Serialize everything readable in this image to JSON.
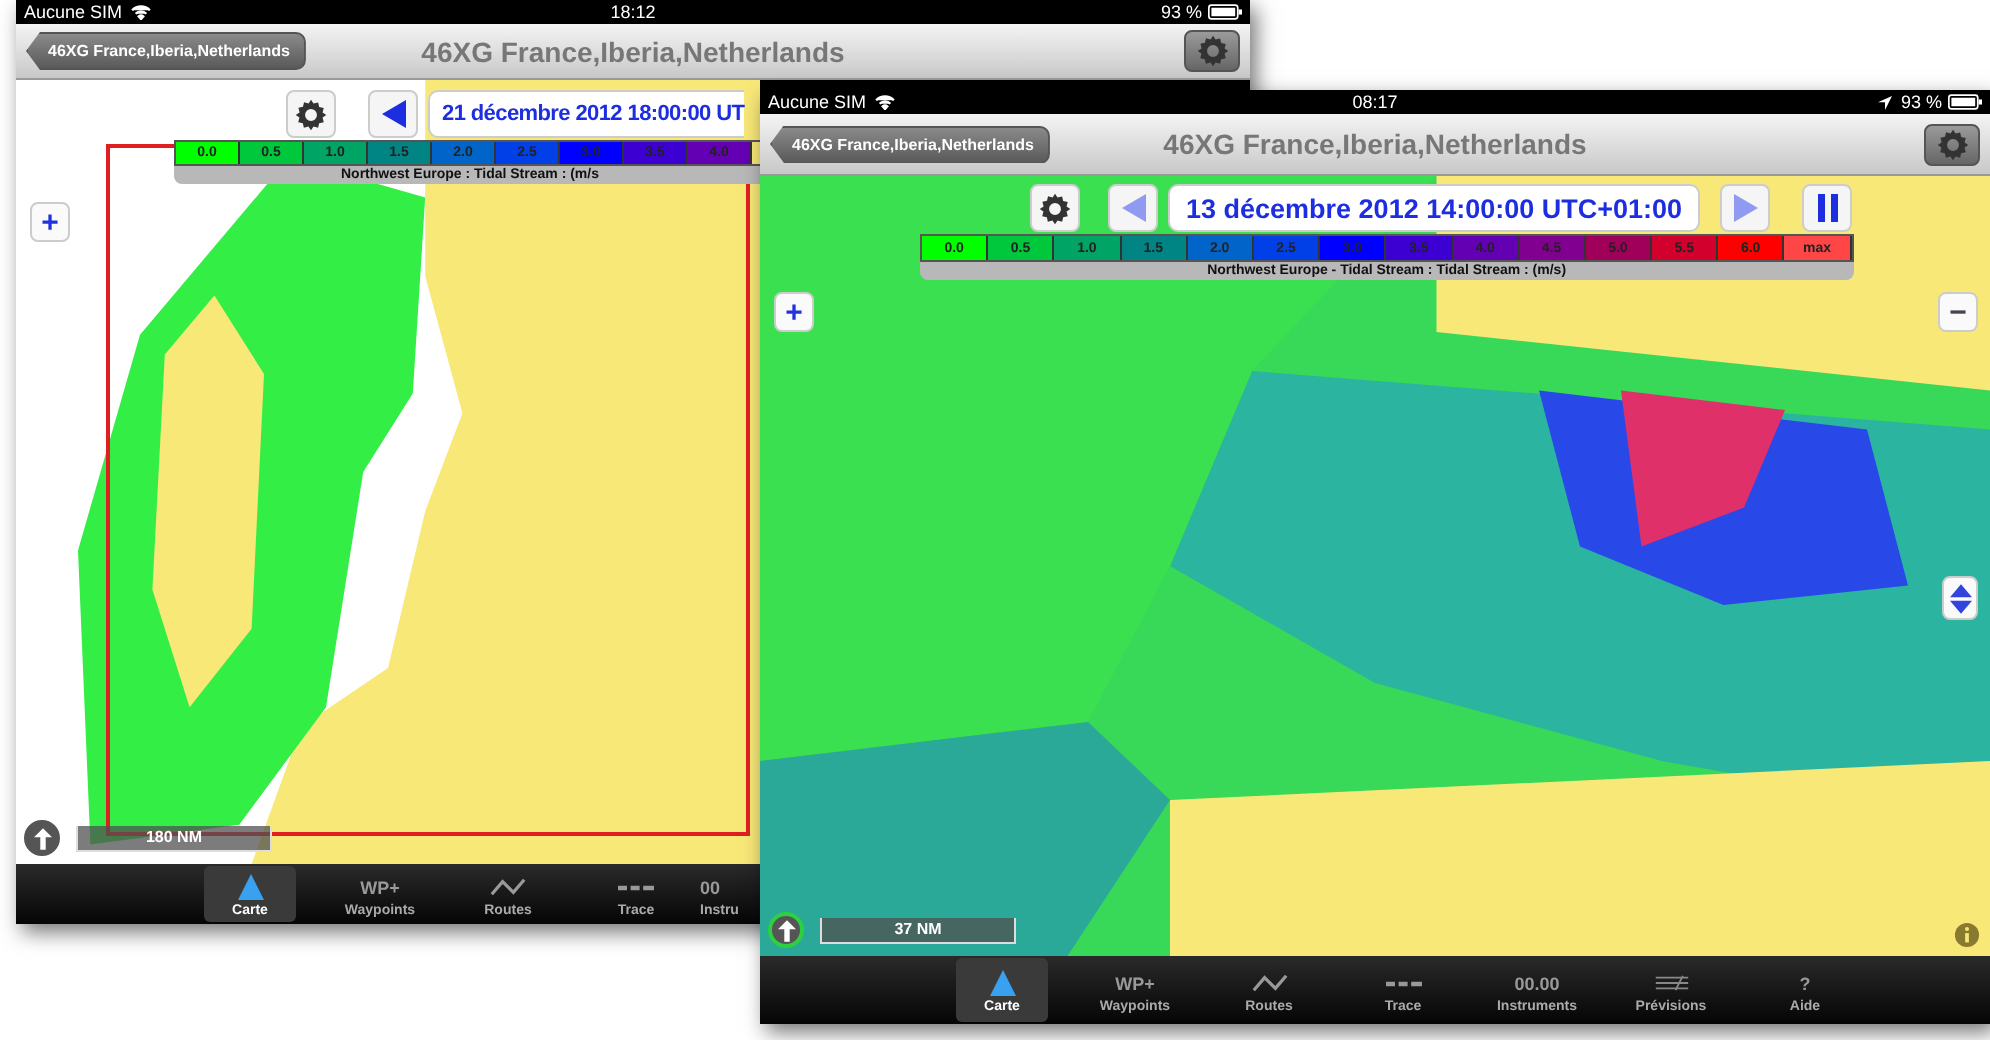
{
  "back_screen": {
    "status_bar": {
      "carrier": "Aucune SIM",
      "time": "18:12",
      "battery": "93 %"
    },
    "nav_bar": {
      "back_button": "46XG France,Iberia,Netherlands",
      "title": "46XG France,Iberia,Netherlands"
    },
    "map_controls": {
      "date": "21 décembre 2012 18:00:00 UT",
      "zoom_in": "+",
      "scale": "180 NM"
    },
    "legend": {
      "cells": [
        {
          "label": "0.0",
          "color": "#00ff00"
        },
        {
          "label": "0.5",
          "color": "#00c83c"
        },
        {
          "label": "1.0",
          "color": "#00a464"
        },
        {
          "label": "1.5",
          "color": "#008484"
        },
        {
          "label": "2.0",
          "color": "#0064c8"
        },
        {
          "label": "2.5",
          "color": "#0040e6"
        },
        {
          "label": "3.0",
          "color": "#0000ff"
        },
        {
          "label": "3.5",
          "color": "#3c00d2"
        },
        {
          "label": "4.0",
          "color": "#6400b4"
        }
      ],
      "caption": "Northwest Europe : Tidal Stream : (m/s"
    },
    "tabs": [
      {
        "label": "Carte",
        "kind": "triangle",
        "selected": true
      },
      {
        "label": "Waypoints",
        "kind": "text",
        "glyph": "WP+",
        "selected": false
      },
      {
        "label": "Routes",
        "kind": "zigzag",
        "selected": false
      },
      {
        "label": "Trace",
        "kind": "dashes",
        "selected": false
      },
      {
        "label": "Instru",
        "kind": "text",
        "glyph": "00",
        "selected": false
      }
    ]
  },
  "front_screen": {
    "status_bar": {
      "carrier": "Aucune SIM",
      "time": "08:17",
      "battery": "93 %"
    },
    "nav_bar": {
      "back_button": "46XG France,Iberia,Netherlands",
      "title": "46XG France,Iberia,Netherlands"
    },
    "map_controls": {
      "date": "13 décembre 2012 14:00:00 UTC+01:00",
      "zoom_in": "+",
      "zoom_out": "−",
      "scale": "37 NM"
    },
    "legend": {
      "cells": [
        {
          "label": "0.0",
          "color": "#00ff00"
        },
        {
          "label": "0.5",
          "color": "#00c83c"
        },
        {
          "label": "1.0",
          "color": "#00a464"
        },
        {
          "label": "1.5",
          "color": "#008484"
        },
        {
          "label": "2.0",
          "color": "#0064c8"
        },
        {
          "label": "2.5",
          "color": "#0040e6"
        },
        {
          "label": "3.0",
          "color": "#0000ff"
        },
        {
          "label": "3.5",
          "color": "#3c00d2"
        },
        {
          "label": "4.0",
          "color": "#6400b4"
        },
        {
          "label": "4.5",
          "color": "#820090"
        },
        {
          "label": "5.0",
          "color": "#a0005a"
        },
        {
          "label": "5.5",
          "color": "#d2002d"
        },
        {
          "label": "6.0",
          "color": "#ff0000"
        },
        {
          "label": "max",
          "color": "#ff4646"
        }
      ],
      "caption": "Northwest Europe - Tidal Stream : Tidal Stream : (m/s)"
    },
    "tabs": [
      {
        "label": "Carte",
        "kind": "triangle",
        "selected": true
      },
      {
        "label": "Waypoints",
        "kind": "text",
        "glyph": "WP+",
        "selected": false
      },
      {
        "label": "Routes",
        "kind": "zigzag",
        "selected": false
      },
      {
        "label": "Trace",
        "kind": "dashes",
        "selected": false
      },
      {
        "label": "Instruments",
        "kind": "text",
        "glyph": "00.00",
        "selected": false
      },
      {
        "label": "Prévisions",
        "kind": "chart",
        "selected": false
      },
      {
        "label": "Aide",
        "kind": "text",
        "glyph": "?",
        "selected": false
      }
    ]
  }
}
